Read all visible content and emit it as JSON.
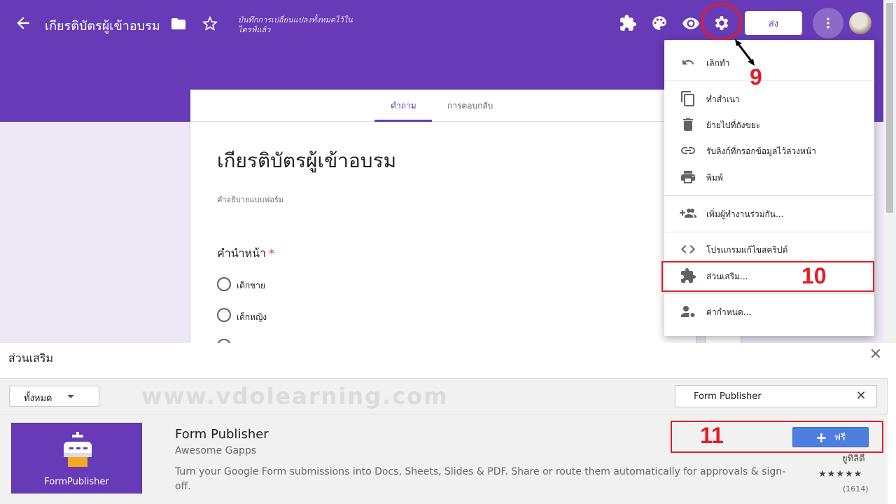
{
  "header": {
    "title": "เกียรติบัตรผู้เข้าอบรม",
    "saved_status": "บันทึกการเปลี่ยนแปลงทั้งหมดไว้ในไดรฟ์แล้ว",
    "send_label": "ส่ง",
    "icons": [
      "back-arrow-icon",
      "folder-icon",
      "star-icon",
      "puzzle-icon",
      "palette-icon",
      "eye-icon",
      "gear-icon",
      "more-vert-icon"
    ]
  },
  "form": {
    "tabs": [
      "คำถาม",
      "การตอบกลับ"
    ],
    "title": "เกียรติบัตรผู้เข้าอบรม",
    "description_placeholder": "คำอธิบายแบบฟอร์ม",
    "question": {
      "title": "คำนำหน้า",
      "required_mark": "*",
      "options": [
        "เด็กชาย",
        "เด็กหญิง"
      ]
    }
  },
  "menu": {
    "items": [
      {
        "label": "เลิกทำ",
        "icon": "undo-icon"
      },
      {
        "label": "ทำสำเนา",
        "icon": "copy-icon"
      },
      {
        "label": "ย้ายไปที่ถังขยะ",
        "icon": "trash-icon"
      },
      {
        "label": "รับลิงก์ที่กรอกข้อมูลไว้ล่วงหน้า",
        "icon": "link-icon"
      },
      {
        "label": "พิมพ์",
        "icon": "print-icon"
      },
      {
        "label": "เพิ่มผู้ทำงานร่วมกัน...",
        "icon": "add-person-icon"
      },
      {
        "label": "โปรแกรมแก้ไขสคริปต์",
        "icon": "code-icon"
      },
      {
        "label": "ส่วนเสริม...",
        "icon": "puzzle-icon"
      },
      {
        "label": "ค่ากำหนด...",
        "icon": "person-settings-icon"
      }
    ]
  },
  "annotations": {
    "step9": "9",
    "step10": "10",
    "step11": "11",
    "accent": "#e51c23"
  },
  "addons_dialog": {
    "title": "ส่วนเสริม",
    "category": "ทั้งหมด",
    "watermark": "www.vdolearning.com",
    "search_value": "Form Publisher",
    "addon": {
      "tile_name": "FormPublisher",
      "name": "Form Publisher",
      "developer": "Awesome Gapps",
      "description": "Turn your Google Form submissions into Docs, Sheets, Slides & PDF. Share or route them automatically for approvals & sign-off.",
      "free_label": "ฟรี",
      "meta": "ยูทิลิตี",
      "rating": 4.5,
      "stars": "★★★★★",
      "reviews": "(1614)"
    }
  },
  "colors": {
    "primary": "#673ab7",
    "button_blue": "#4d7ee0"
  }
}
